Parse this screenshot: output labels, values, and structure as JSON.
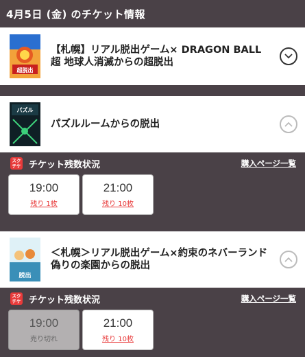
{
  "date_header": "4月5日 (金) のチケット情報",
  "events": [
    {
      "title": "【札幌】リアル脱出ゲーム× DRAGON BALL超 地球人消滅からの超脱出",
      "thumb_text": "超脱出",
      "expand_icon": "chevron-down-icon"
    },
    {
      "title": "パズルルームからの脱出",
      "thumb_text": "パズル",
      "expand_icon": "chevron-up-icon"
    },
    {
      "title": "＜札幌＞リアル脱出ゲーム×約束のネバーランド 偽りの楽園からの脱出",
      "thumb_text": "脱出",
      "expand_icon": "chevron-up-icon"
    }
  ],
  "ticket_sections": [
    {
      "logo_text": [
        "スク",
        "チケ"
      ],
      "heading": "チケット残数状況",
      "purchase_link": "購入ページ一覧",
      "slots": [
        {
          "time": "19:00",
          "status": "残り 1枚",
          "sold_out": false
        },
        {
          "time": "21:00",
          "status": "残り 10枚",
          "sold_out": false
        }
      ]
    },
    {
      "logo_text": [
        "スク",
        "チケ"
      ],
      "heading": "チケット残数状況",
      "purchase_link": "購入ページ一覧",
      "slots": [
        {
          "time": "19:00",
          "status": "売り切れ",
          "sold_out": true
        },
        {
          "time": "21:00",
          "status": "残り 10枚",
          "sold_out": false
        }
      ]
    }
  ],
  "colors": {
    "background": "#4a4147",
    "accent_red": "#e83a3a",
    "soldout_gray": "#b3b0b1"
  }
}
